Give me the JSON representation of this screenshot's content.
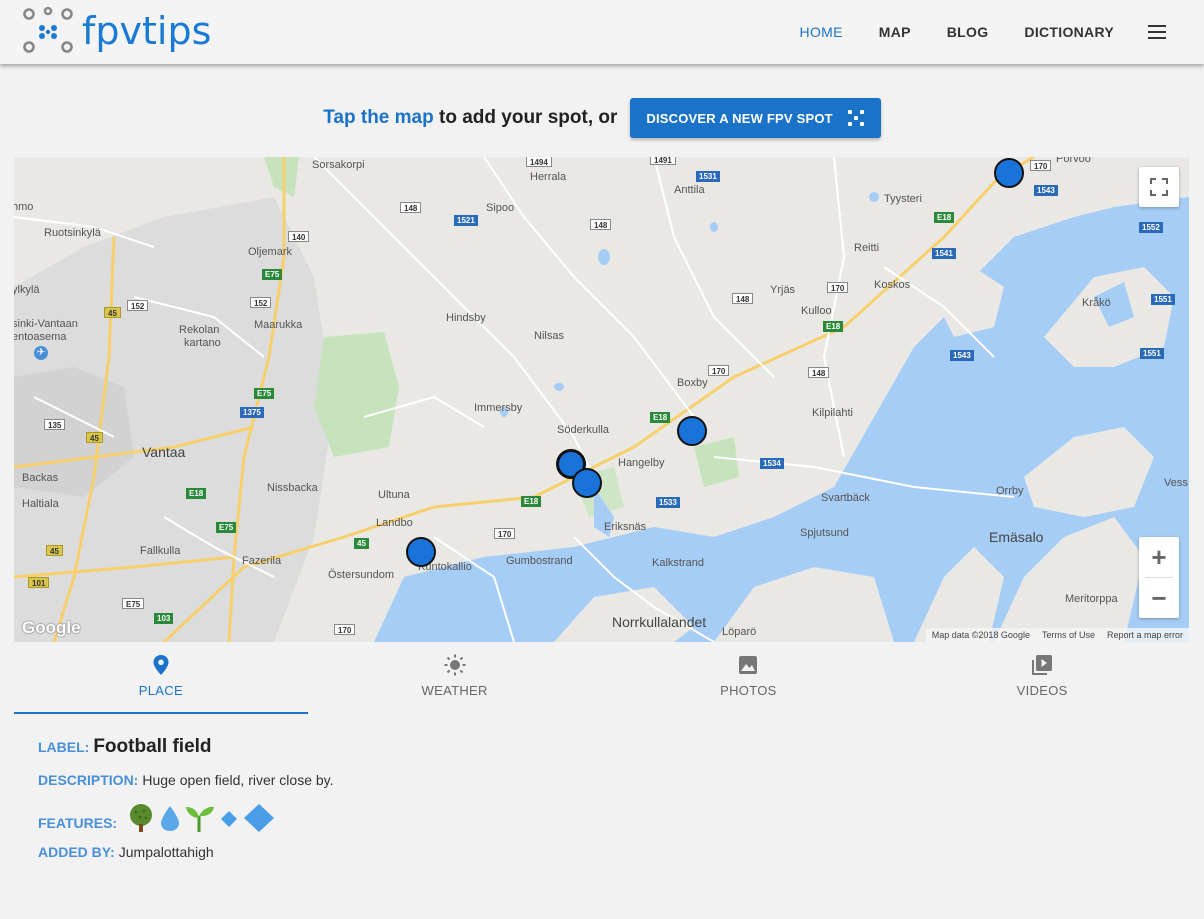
{
  "header": {
    "logo_text": "fpvtips",
    "nav": [
      {
        "label": "HOME",
        "active": true
      },
      {
        "label": "MAP",
        "active": false
      },
      {
        "label": "BLOG",
        "active": false
      },
      {
        "label": "DICTIONARY",
        "active": false
      }
    ],
    "menu_icon": "hamburger-icon"
  },
  "cta": {
    "link_text": "Tap the map",
    "rest_text": "to add your spot, or",
    "button_label": "DISCOVER A NEW FPV SPOT",
    "button_icon": "dice-icon"
  },
  "map": {
    "places": [
      "Sorsakorpi",
      "Herrala",
      "Anttila",
      "Porvoo",
      "Tyysteri",
      "hmo",
      "Ruotsinkylä",
      "Oljemark",
      "Sipoo",
      "Reitti",
      "ylkylä",
      "Yrjäs",
      "Koskos",
      "Kråkö",
      "sinki-Vantaan",
      "entoasema",
      "Rekolan",
      "kartano",
      "Maarukka",
      "Hindsby",
      "Nilsas",
      "Kulloo",
      "Boxby",
      "Kilpilahti",
      "Immersby",
      "Söderkulla",
      "Hangelby",
      "Vantaa",
      "Backas",
      "Haltiala",
      "Nissbacka",
      "Ultuna",
      "Svartbäck",
      "Orrby",
      "Landbo",
      "Eriksnäs",
      "Spjutsund",
      "Emäsalo",
      "Fallkulla",
      "Fazerila",
      "Kuntokallio",
      "Gumbostrand",
      "Kalkstrand",
      "Östersundom",
      "Meritorppa",
      "Norrkullalandet",
      "Löparö",
      "Vess"
    ],
    "roads": [
      "1494",
      "1491",
      "1531",
      "170",
      "1543",
      "148",
      "1521",
      "148",
      "E18",
      "1552",
      "140",
      "E75",
      "1541",
      "152",
      "152",
      "170",
      "148",
      "1551",
      "45",
      "E18",
      "1543",
      "1551",
      "170",
      "148",
      "E75",
      "1375",
      "E18",
      "135",
      "45",
      "1534",
      "E18",
      "1533",
      "E18",
      "E75",
      "170",
      "45",
      "45",
      "101",
      "E75",
      "103",
      "170"
    ],
    "attribution": [
      "Map data ©2018 Google",
      "Terms of Use",
      "Report a map error"
    ],
    "google_logo": "Google",
    "fullscreen_icon": "fullscreen-icon",
    "zoom_in": "+",
    "zoom_out": "−"
  },
  "tabs": [
    {
      "label": "PLACE",
      "icon": "location-pin-icon",
      "active": true
    },
    {
      "label": "WEATHER",
      "icon": "sun-icon",
      "active": false
    },
    {
      "label": "PHOTOS",
      "icon": "photo-icon",
      "active": false
    },
    {
      "label": "VIDEOS",
      "icon": "video-library-icon",
      "active": false
    }
  ],
  "details": {
    "label_label": "LABEL:",
    "label_value": "Football field",
    "description_label": "DESCRIPTION:",
    "description_value": "Huge open field, river close by.",
    "features_label": "FEATURES:",
    "features": [
      "tree-icon",
      "water-drop-icon",
      "sprout-icon",
      "small-diamond-icon",
      "large-diamond-icon"
    ],
    "added_by_label": "ADDED BY:",
    "added_by_value": "Jumpalottahigh"
  },
  "colors": {
    "accent": "#1a73c9",
    "marker": "#1a73d9",
    "water": "#a6cdf5",
    "park": "#c7e3bd"
  }
}
